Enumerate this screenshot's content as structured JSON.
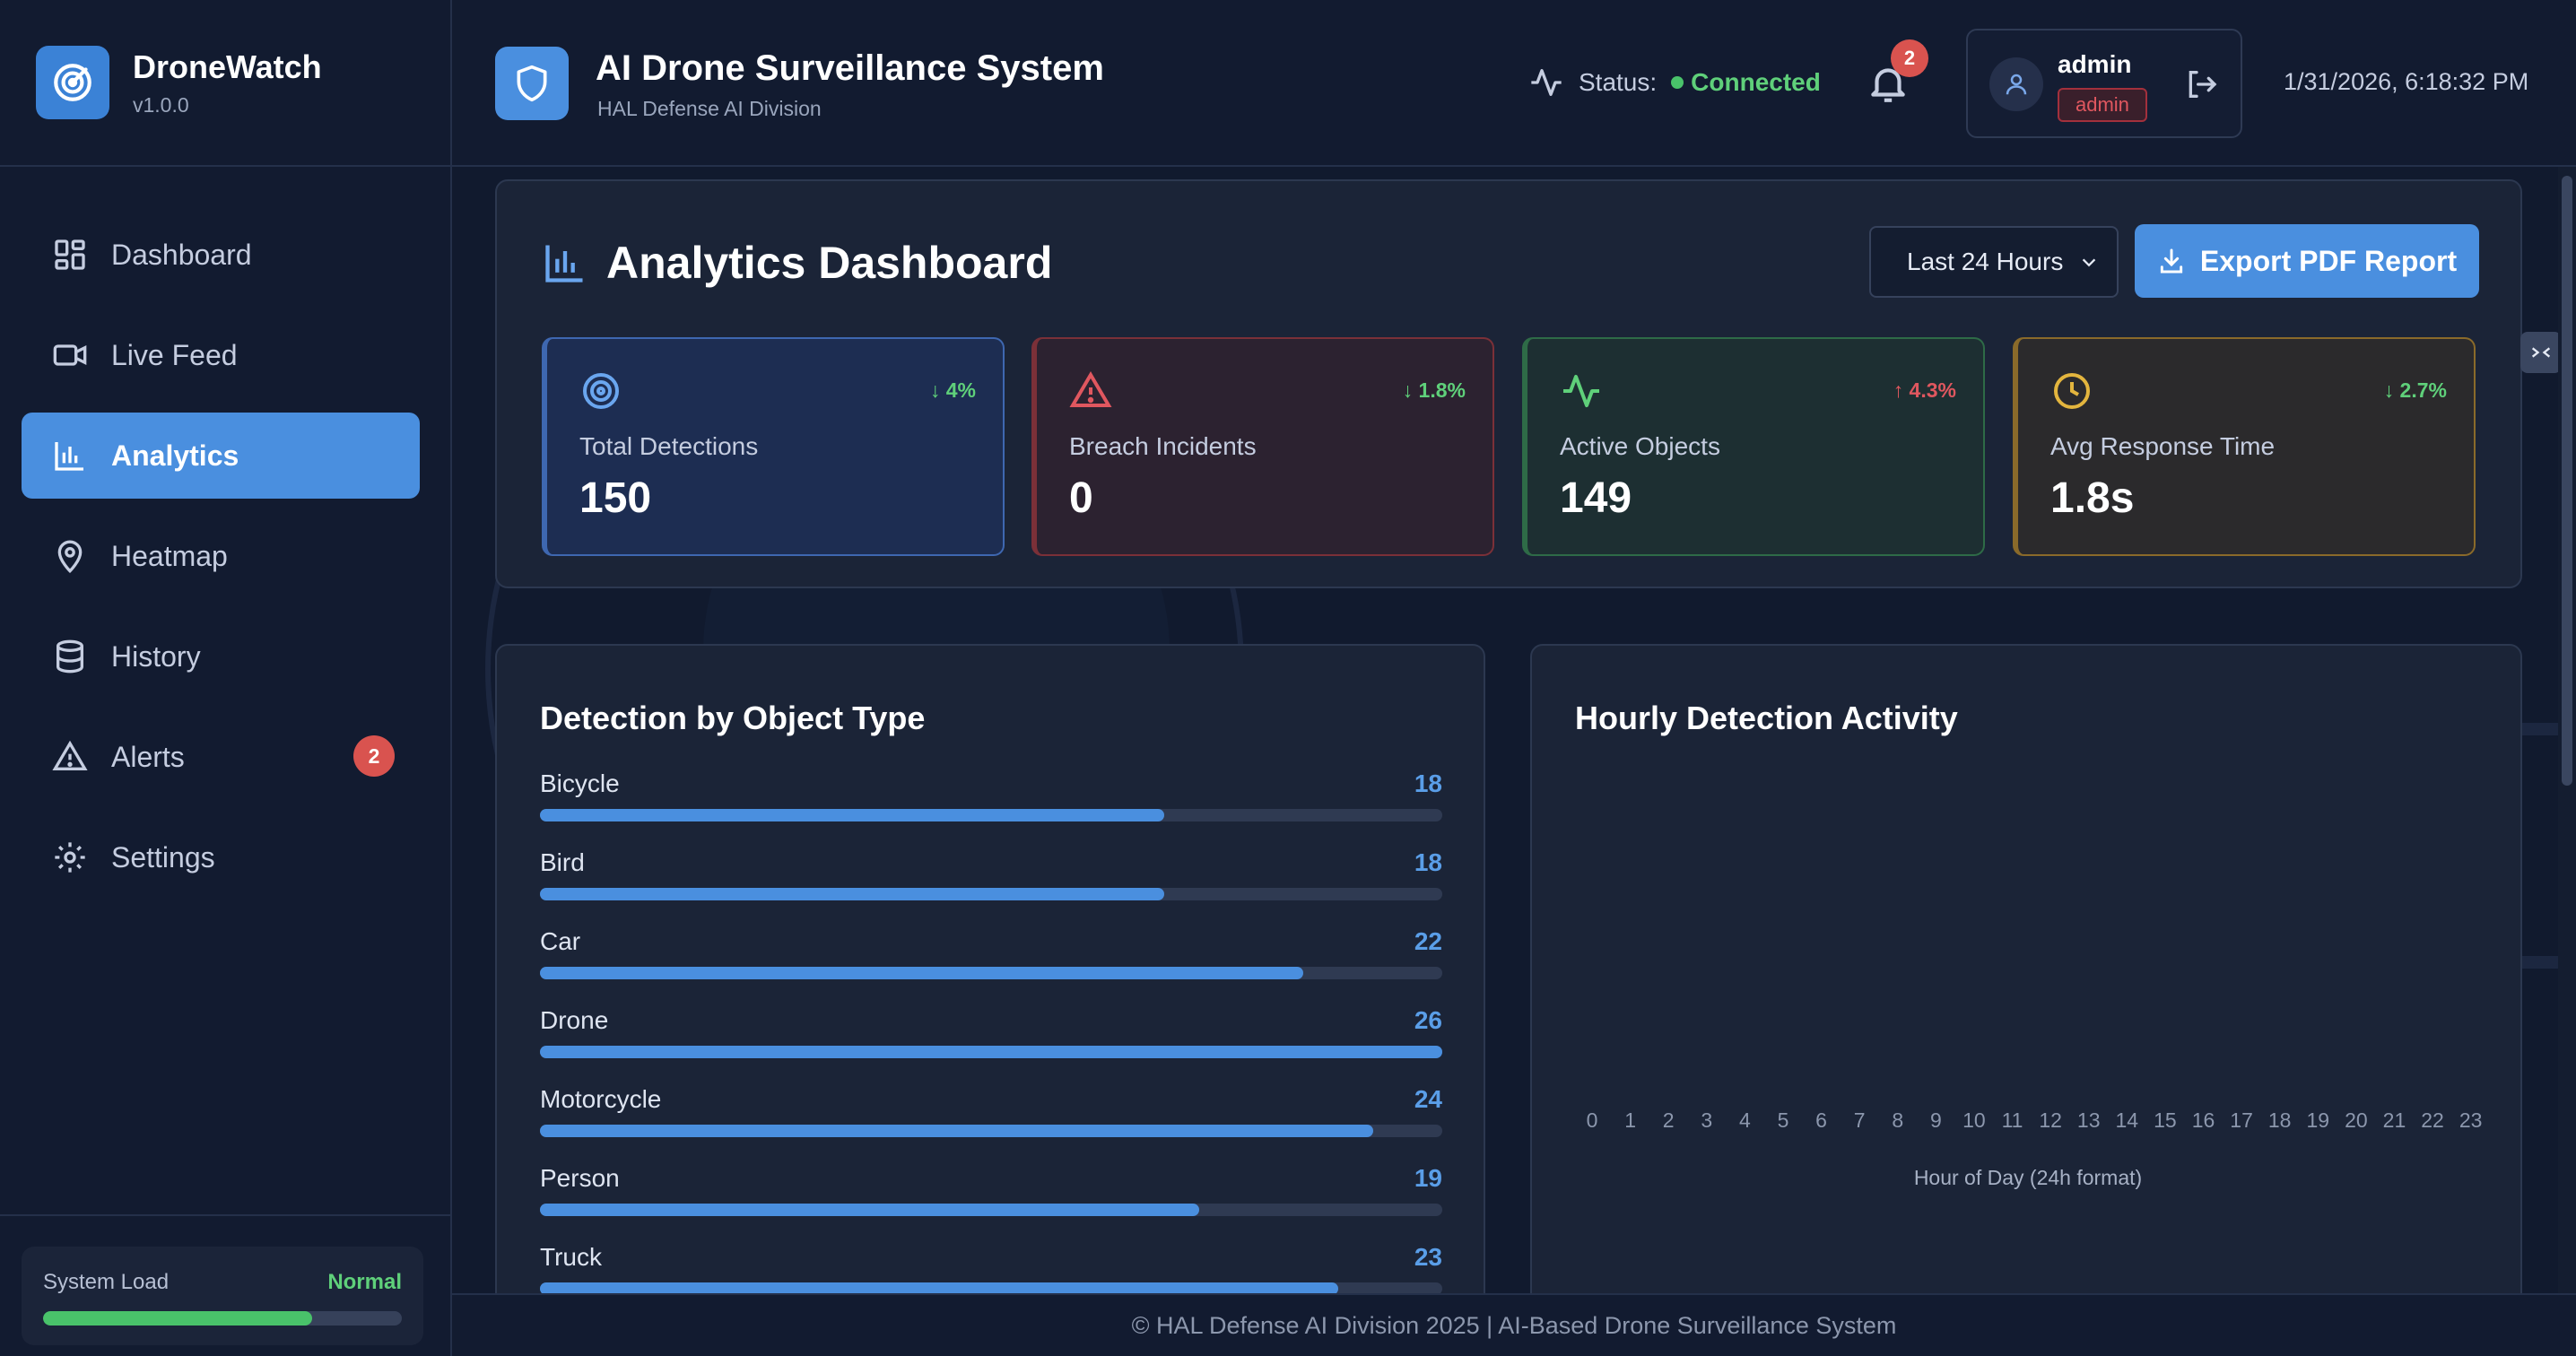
{
  "brand": {
    "name": "DroneWatch",
    "version": "v1.0.0"
  },
  "nav": [
    {
      "label": "Dashboard",
      "icon": "dashboard-icon"
    },
    {
      "label": "Live Feed",
      "icon": "video-icon"
    },
    {
      "label": "Analytics",
      "icon": "bar-chart-icon",
      "active": true
    },
    {
      "label": "Heatmap",
      "icon": "map-pin-icon"
    },
    {
      "label": "History",
      "icon": "database-icon"
    },
    {
      "label": "Alerts",
      "icon": "alert-triangle-icon",
      "badge": "2"
    },
    {
      "label": "Settings",
      "icon": "gear-icon"
    }
  ],
  "system_load": {
    "label": "System Load",
    "status": "Normal",
    "level": 0.75
  },
  "header": {
    "title": "AI Drone Surveillance System",
    "subtitle": "HAL Defense AI Division",
    "status_label": "Status:",
    "status_value": "Connected",
    "notifications": "2",
    "user": {
      "name": "admin",
      "role": "admin"
    },
    "datetime": "1/31/2026, 6:18:32 PM"
  },
  "dashboard": {
    "title": "Analytics Dashboard",
    "range": "Last 24 Hours",
    "export_label": "Export PDF Report",
    "stats": [
      {
        "label": "Total Detections",
        "value": "150",
        "delta": "↓ 4%",
        "icon": "target-icon"
      },
      {
        "label": "Breach Incidents",
        "value": "0",
        "delta": "↓ 1.8%",
        "icon": "alert-triangle-icon"
      },
      {
        "label": "Active Objects",
        "value": "149",
        "delta": "↑ 4.3%",
        "icon": "activity-icon"
      },
      {
        "label": "Avg Response Time",
        "value": "1.8s",
        "delta": "↓ 2.7%",
        "icon": "clock-icon"
      }
    ]
  },
  "object_types": {
    "title": "Detection by Object Type",
    "max": 26,
    "items": [
      {
        "label": "Bicycle",
        "count": 18
      },
      {
        "label": "Bird",
        "count": 18
      },
      {
        "label": "Car",
        "count": 22
      },
      {
        "label": "Drone",
        "count": 26
      },
      {
        "label": "Motorcycle",
        "count": 24
      },
      {
        "label": "Person",
        "count": 19
      },
      {
        "label": "Truck",
        "count": 23
      }
    ]
  },
  "hourly": {
    "title": "Hourly Detection Activity",
    "hours": [
      "0",
      "1",
      "2",
      "3",
      "4",
      "5",
      "6",
      "7",
      "8",
      "9",
      "10",
      "11",
      "12",
      "13",
      "14",
      "15",
      "16",
      "17",
      "18",
      "19",
      "20",
      "21",
      "22",
      "23"
    ],
    "xlabel": "Hour of Day (24h format)"
  },
  "footer": "© HAL Defense AI Division 2025 | AI-Based Drone Surveillance System"
}
